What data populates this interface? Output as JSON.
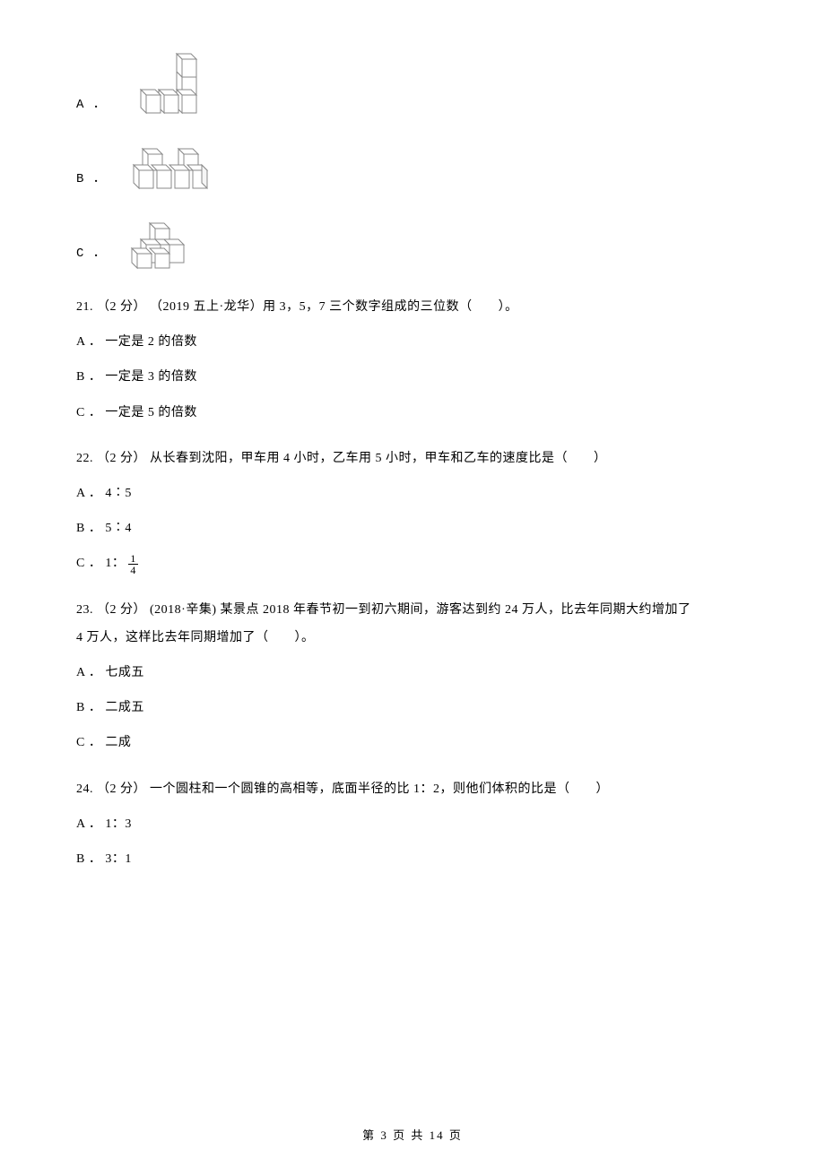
{
  "options_top": {
    "A": "A ．",
    "B": "B ．",
    "C": "C ．"
  },
  "q21": {
    "stem": "21.  （2 分） （2019 五上·龙华）用 3，5，7 三个数字组成的三位数（　　）。",
    "A": "A ． 一定是 2 的倍数",
    "B": "B ． 一定是 3 的倍数",
    "C": "C ． 一定是 5 的倍数"
  },
  "q22": {
    "stem": "22.  （2 分）  从长春到沈阳，甲车用 4 小时，乙车用 5 小时，甲车和乙车的速度比是（　　）",
    "A": "A ． 4∶5",
    "B": "B ． 5∶4",
    "C_prefix": "C ． 1：",
    "C_num": "1",
    "C_den": "4"
  },
  "q23": {
    "stem_line1": "23.  （2 分） (2018·辛集) 某景点 2018 年春节初一到初六期间，游客达到约 24 万人，比去年同期大约增加了",
    "stem_line2": "4 万人，这样比去年同期增加了（　　）。",
    "A": "A ． 七成五",
    "B": "B ． 二成五",
    "C": "C ． 二成"
  },
  "q24": {
    "stem": "24.  （2 分）  一个圆柱和一个圆锥的高相等，底面半径的比 1：2，则他们体积的比是（　　）",
    "A": "A ． 1：3",
    "B": "B ． 3：1"
  },
  "footer": "第 3 页 共 14 页"
}
